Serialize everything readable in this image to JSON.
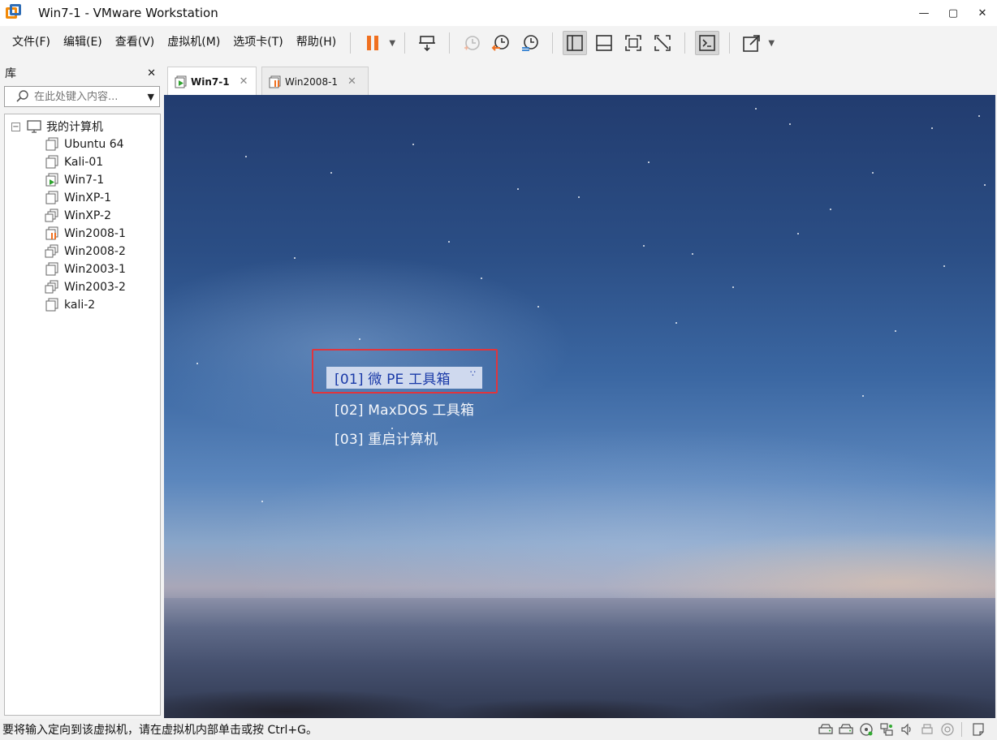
{
  "window": {
    "title": "Win7-1 - VMware Workstation",
    "controls": [
      "—",
      "▢",
      "✕"
    ]
  },
  "menu": {
    "items": [
      "文件(F)",
      "编辑(E)",
      "查看(V)",
      "虚拟机(M)",
      "选项卡(T)",
      "帮助(H)"
    ]
  },
  "toolbar": {
    "icons": [
      "pause-icon",
      "send-ctrl-alt-del-icon",
      "snapshot-icon",
      "revert-snapshot-icon",
      "snapshot-manager-icon",
      "library-view-icon",
      "thumbnail-bar-icon",
      "full-screen-icon",
      "unity-icon",
      "console-view-icon",
      "stretch-icon"
    ],
    "accent_color": "#f07020"
  },
  "library": {
    "title": "库",
    "close": "✕",
    "search_placeholder": "在此处键入内容...",
    "root_label": "我的计算机",
    "root_expander": "−",
    "vms": [
      {
        "label": "Ubuntu 64",
        "state": "off"
      },
      {
        "label": "Kali-01",
        "state": "off"
      },
      {
        "label": "Win7-1",
        "state": "running"
      },
      {
        "label": "WinXP-1",
        "state": "off"
      },
      {
        "label": "WinXP-2",
        "state": "clone"
      },
      {
        "label": "Win2008-1",
        "state": "paused"
      },
      {
        "label": "Win2008-2",
        "state": "clone"
      },
      {
        "label": "Win2003-1",
        "state": "off"
      },
      {
        "label": "Win2003-2",
        "state": "clone"
      },
      {
        "label": "kali-2",
        "state": "off"
      }
    ]
  },
  "tabs": [
    {
      "label": "Win7-1",
      "close": "✕",
      "active": true,
      "state": "running"
    },
    {
      "label": "Win2008-1",
      "close": "✕",
      "active": false,
      "state": "paused"
    }
  ],
  "vm_screen": {
    "boot_menu": [
      {
        "label": "[01] 微 PE 工具箱",
        "selected": true
      },
      {
        "label": "[02] MaxDOS 工具箱",
        "selected": false
      },
      {
        "label": "[03] 重启计算机",
        "selected": false
      }
    ],
    "highlight_color": "#e0353d"
  },
  "statusbar": {
    "message": "要将输入定向到该虚拟机，请在虚拟机内部单击或按 Ctrl+G。",
    "icons": [
      "hard-disk-icon",
      "hard-disk-2-icon",
      "cd-dvd-icon",
      "network-adapter-icon",
      "sound-icon",
      "printer-icon",
      "display-icon",
      "message-log-icon"
    ]
  }
}
